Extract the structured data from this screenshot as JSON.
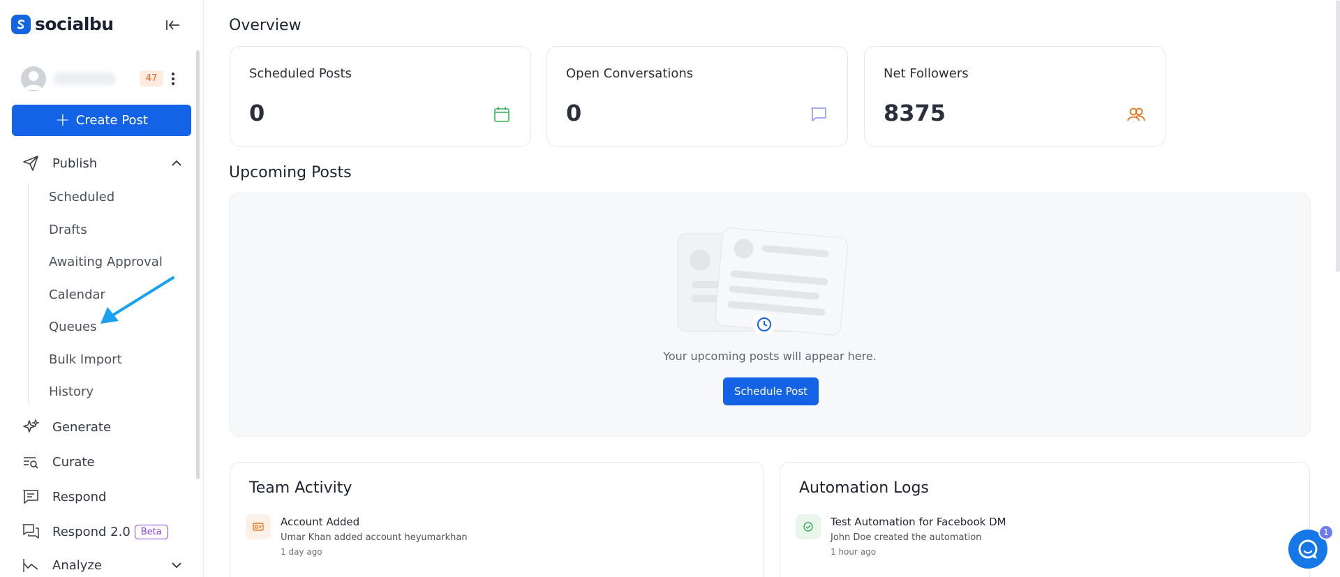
{
  "brand": {
    "name": "socialbu"
  },
  "user": {
    "notification_count": "47"
  },
  "sidebar": {
    "create_post_label": "Create Post",
    "publish_label": "Publish",
    "publish_items": [
      "Scheduled",
      "Drafts",
      "Awaiting Approval",
      "Calendar",
      "Queues",
      "Bulk Import",
      "History"
    ],
    "generate_label": "Generate",
    "curate_label": "Curate",
    "respond_label": "Respond",
    "respond2_label": "Respond 2.0",
    "beta_label": "Beta",
    "analyze_label": "Analyze"
  },
  "overview": {
    "title": "Overview",
    "cards": [
      {
        "label": "Scheduled Posts",
        "value": "0",
        "icon": "calendar-icon",
        "color": "#4cbb6a"
      },
      {
        "label": "Open Conversations",
        "value": "0",
        "icon": "chat-bubble-icon",
        "color": "#9aa0f5"
      },
      {
        "label": "Net Followers",
        "value": "8375",
        "icon": "users-icon",
        "color": "#e6761c"
      }
    ]
  },
  "upcoming": {
    "title": "Upcoming Posts",
    "empty_text": "Your upcoming posts will appear here.",
    "button_label": "Schedule Post"
  },
  "team_activity": {
    "title": "Team Activity",
    "item": {
      "title": "Account Added",
      "desc": "Umar Khan added account heyumarkhan",
      "time": "1 day ago"
    }
  },
  "automation_logs": {
    "title": "Automation Logs",
    "item": {
      "title": "Test Automation for Facebook DM",
      "desc": "John Doe created the automation",
      "time": "1 hour ago"
    }
  },
  "chat": {
    "badge": "1"
  },
  "colors": {
    "primary": "#1463e6",
    "beta": "#8b3fe0",
    "badge_bg": "#fdebe0",
    "badge_text": "#e2661c",
    "arrow": "#1aa1f0"
  }
}
